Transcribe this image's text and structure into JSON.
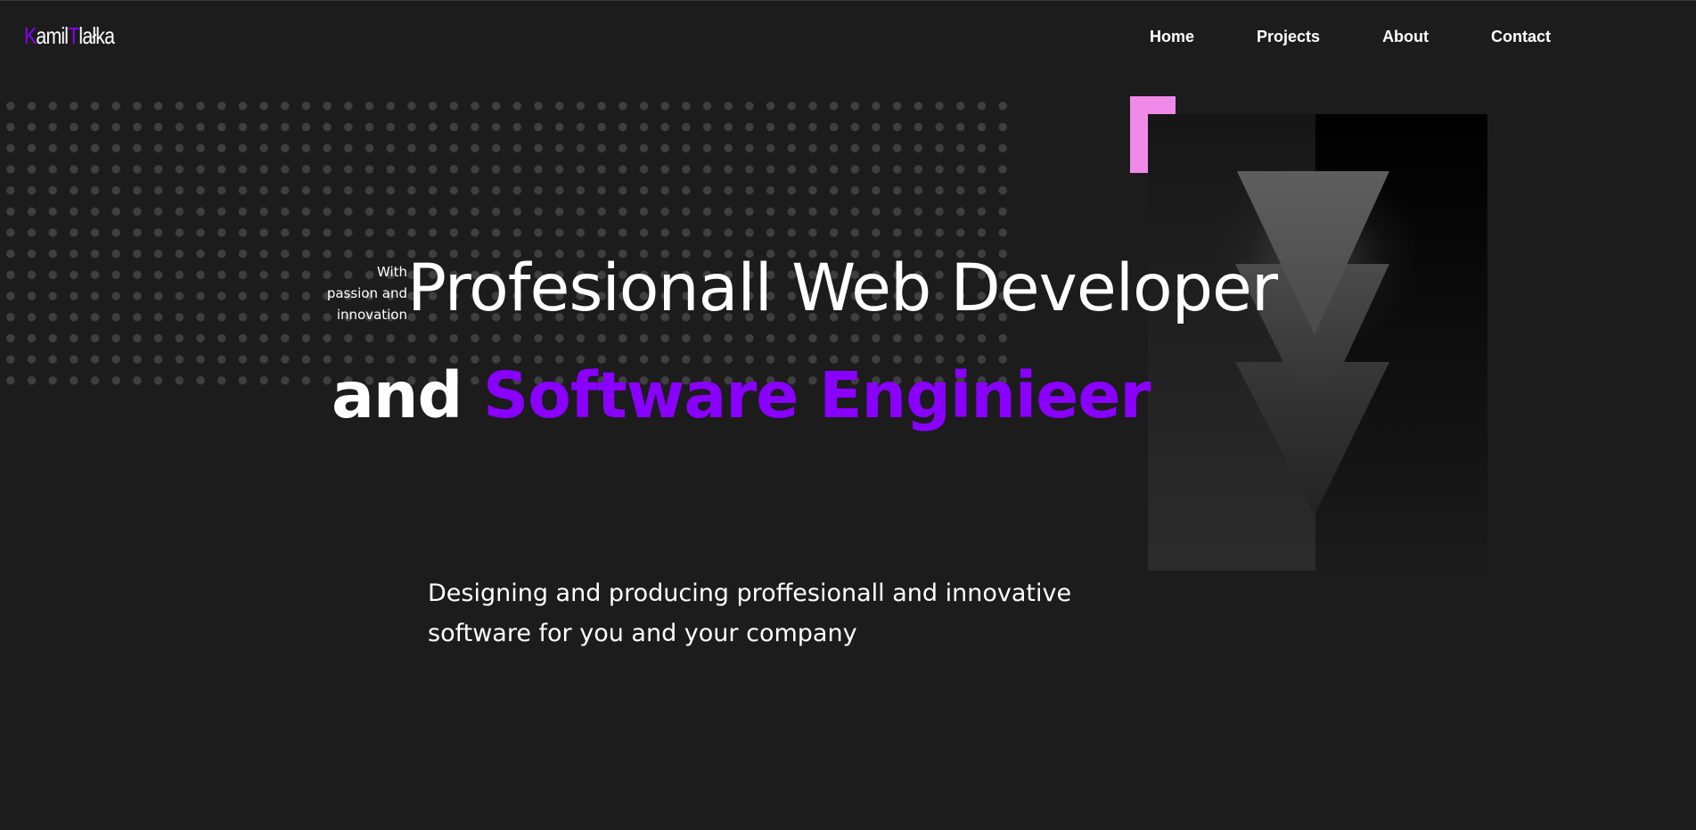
{
  "header": {
    "logo": {
      "first": "K",
      "part1": "amil",
      "second": "T",
      "part2": "lałka"
    },
    "nav": [
      {
        "label": "Home"
      },
      {
        "label": "Projects"
      },
      {
        "label": "About"
      },
      {
        "label": "Contact"
      }
    ]
  },
  "hero": {
    "side_note": [
      "With",
      "passion and",
      "innovation"
    ],
    "headline_line1": "Profesionall Web Developer",
    "headline_line2_prefix": "and ",
    "headline_line2_highlight": "Software Enginieer",
    "tagline_line1": "Designing and producing proffesionall and innovative",
    "tagline_line2": "software for you and your company"
  },
  "colors": {
    "background": "#1c1c1d",
    "accent_purple": "#8a00ff",
    "accent_pink": "#f08ae8",
    "dot_gray": "#3f3f41",
    "text": "#ffffff"
  }
}
